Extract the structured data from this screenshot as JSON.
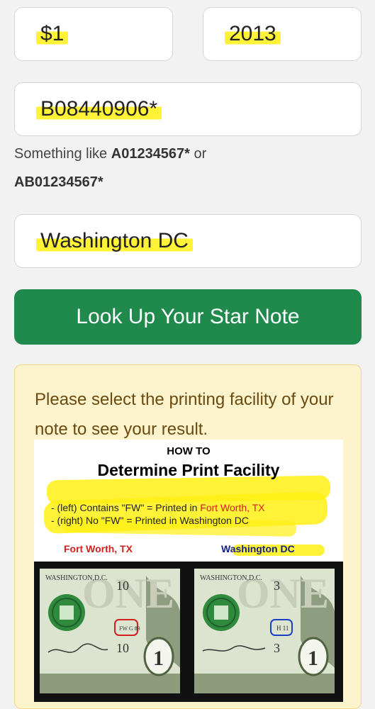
{
  "form": {
    "denomination": "$1",
    "year": "2013",
    "serial": "B08440906*",
    "hint_prefix": "Something like ",
    "hint_example1": "A01234567*",
    "hint_or": " or ",
    "hint_example2": "AB01234567*",
    "location": "Washington DC",
    "lookup_label": "Look Up Your Star Note"
  },
  "result": {
    "message": "Please select the printing facility of your note to see your result."
  },
  "infographic": {
    "eyebrow": "HOW TO",
    "title": "Determine Print Facility",
    "line1_prefix": "- (left) Contains \"FW\" = Printed in ",
    "line1_place": "Fort Worth, TX",
    "line2": "- (right) No \"FW\" = Printed in Washington DC",
    "label_left": "Fort Worth, TX",
    "label_right": "Washington DC",
    "left_bill": {
      "city": "WASHINGTON,D.C.",
      "number": "10",
      "plate": "FW G 89",
      "number2": "10",
      "denom": "1"
    },
    "right_bill": {
      "city": "WASHINGTON,D.C.",
      "number": "3",
      "plate": "H 11",
      "number2": "3",
      "denom": "1"
    }
  },
  "colors": {
    "button": "#1f8a4c",
    "panel": "#fdf3cc",
    "panel_text": "#6b4a10",
    "highlight": "#fff014",
    "fort_worth": "#d21f1f",
    "washington": "#14208a"
  }
}
